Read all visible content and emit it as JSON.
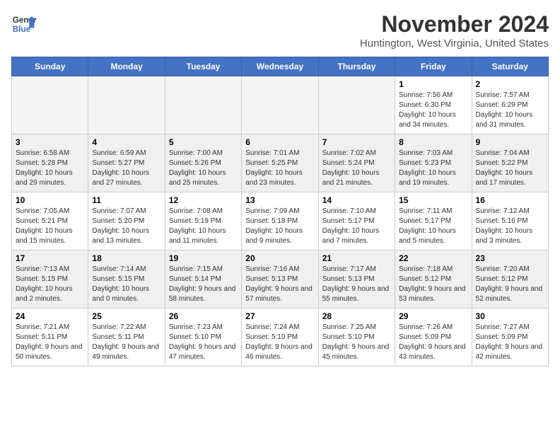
{
  "app": {
    "name": "GeneralBlue",
    "logo_line1": "General",
    "logo_line2": "Blue"
  },
  "calendar": {
    "month": "November 2024",
    "location": "Huntington, West Virginia, United States",
    "headers": [
      "Sunday",
      "Monday",
      "Tuesday",
      "Wednesday",
      "Thursday",
      "Friday",
      "Saturday"
    ],
    "weeks": [
      [
        {
          "day": "",
          "empty": true
        },
        {
          "day": "",
          "empty": true
        },
        {
          "day": "",
          "empty": true
        },
        {
          "day": "",
          "empty": true
        },
        {
          "day": "",
          "empty": true
        },
        {
          "day": "1",
          "sunrise": "Sunrise: 7:56 AM",
          "sunset": "Sunset: 6:30 PM",
          "daylight": "Daylight: 10 hours and 34 minutes."
        },
        {
          "day": "2",
          "sunrise": "Sunrise: 7:57 AM",
          "sunset": "Sunset: 6:29 PM",
          "daylight": "Daylight: 10 hours and 31 minutes."
        }
      ],
      [
        {
          "day": "3",
          "sunrise": "Sunrise: 6:58 AM",
          "sunset": "Sunset: 5:28 PM",
          "daylight": "Daylight: 10 hours and 29 minutes."
        },
        {
          "day": "4",
          "sunrise": "Sunrise: 6:59 AM",
          "sunset": "Sunset: 5:27 PM",
          "daylight": "Daylight: 10 hours and 27 minutes."
        },
        {
          "day": "5",
          "sunrise": "Sunrise: 7:00 AM",
          "sunset": "Sunset: 5:26 PM",
          "daylight": "Daylight: 10 hours and 25 minutes."
        },
        {
          "day": "6",
          "sunrise": "Sunrise: 7:01 AM",
          "sunset": "Sunset: 5:25 PM",
          "daylight": "Daylight: 10 hours and 23 minutes."
        },
        {
          "day": "7",
          "sunrise": "Sunrise: 7:02 AM",
          "sunset": "Sunset: 5:24 PM",
          "daylight": "Daylight: 10 hours and 21 minutes."
        },
        {
          "day": "8",
          "sunrise": "Sunrise: 7:03 AM",
          "sunset": "Sunset: 5:23 PM",
          "daylight": "Daylight: 10 hours and 19 minutes."
        },
        {
          "day": "9",
          "sunrise": "Sunrise: 7:04 AM",
          "sunset": "Sunset: 5:22 PM",
          "daylight": "Daylight: 10 hours and 17 minutes."
        }
      ],
      [
        {
          "day": "10",
          "sunrise": "Sunrise: 7:05 AM",
          "sunset": "Sunset: 5:21 PM",
          "daylight": "Daylight: 10 hours and 15 minutes."
        },
        {
          "day": "11",
          "sunrise": "Sunrise: 7:07 AM",
          "sunset": "Sunset: 5:20 PM",
          "daylight": "Daylight: 10 hours and 13 minutes."
        },
        {
          "day": "12",
          "sunrise": "Sunrise: 7:08 AM",
          "sunset": "Sunset: 5:19 PM",
          "daylight": "Daylight: 10 hours and 11 minutes."
        },
        {
          "day": "13",
          "sunrise": "Sunrise: 7:09 AM",
          "sunset": "Sunset: 5:18 PM",
          "daylight": "Daylight: 10 hours and 9 minutes."
        },
        {
          "day": "14",
          "sunrise": "Sunrise: 7:10 AM",
          "sunset": "Sunset: 5:17 PM",
          "daylight": "Daylight: 10 hours and 7 minutes."
        },
        {
          "day": "15",
          "sunrise": "Sunrise: 7:11 AM",
          "sunset": "Sunset: 5:17 PM",
          "daylight": "Daylight: 10 hours and 5 minutes."
        },
        {
          "day": "16",
          "sunrise": "Sunrise: 7:12 AM",
          "sunset": "Sunset: 5:16 PM",
          "daylight": "Daylight: 10 hours and 3 minutes."
        }
      ],
      [
        {
          "day": "17",
          "sunrise": "Sunrise: 7:13 AM",
          "sunset": "Sunset: 5:15 PM",
          "daylight": "Daylight: 10 hours and 2 minutes."
        },
        {
          "day": "18",
          "sunrise": "Sunrise: 7:14 AM",
          "sunset": "Sunset: 5:15 PM",
          "daylight": "Daylight: 10 hours and 0 minutes."
        },
        {
          "day": "19",
          "sunrise": "Sunrise: 7:15 AM",
          "sunset": "Sunset: 5:14 PM",
          "daylight": "Daylight: 9 hours and 58 minutes."
        },
        {
          "day": "20",
          "sunrise": "Sunrise: 7:16 AM",
          "sunset": "Sunset: 5:13 PM",
          "daylight": "Daylight: 9 hours and 57 minutes."
        },
        {
          "day": "21",
          "sunrise": "Sunrise: 7:17 AM",
          "sunset": "Sunset: 5:13 PM",
          "daylight": "Daylight: 9 hours and 55 minutes."
        },
        {
          "day": "22",
          "sunrise": "Sunrise: 7:18 AM",
          "sunset": "Sunset: 5:12 PM",
          "daylight": "Daylight: 9 hours and 53 minutes."
        },
        {
          "day": "23",
          "sunrise": "Sunrise: 7:20 AM",
          "sunset": "Sunset: 5:12 PM",
          "daylight": "Daylight: 9 hours and 52 minutes."
        }
      ],
      [
        {
          "day": "24",
          "sunrise": "Sunrise: 7:21 AM",
          "sunset": "Sunset: 5:11 PM",
          "daylight": "Daylight: 9 hours and 50 minutes."
        },
        {
          "day": "25",
          "sunrise": "Sunrise: 7:22 AM",
          "sunset": "Sunset: 5:11 PM",
          "daylight": "Daylight: 9 hours and 49 minutes."
        },
        {
          "day": "26",
          "sunrise": "Sunrise: 7:23 AM",
          "sunset": "Sunset: 5:10 PM",
          "daylight": "Daylight: 9 hours and 47 minutes."
        },
        {
          "day": "27",
          "sunrise": "Sunrise: 7:24 AM",
          "sunset": "Sunset: 5:10 PM",
          "daylight": "Daylight: 9 hours and 46 minutes."
        },
        {
          "day": "28",
          "sunrise": "Sunrise: 7:25 AM",
          "sunset": "Sunset: 5:10 PM",
          "daylight": "Daylight: 9 hours and 45 minutes."
        },
        {
          "day": "29",
          "sunrise": "Sunrise: 7:26 AM",
          "sunset": "Sunset: 5:09 PM",
          "daylight": "Daylight: 9 hours and 43 minutes."
        },
        {
          "day": "30",
          "sunrise": "Sunrise: 7:27 AM",
          "sunset": "Sunset: 5:09 PM",
          "daylight": "Daylight: 9 hours and 42 minutes."
        }
      ]
    ]
  }
}
